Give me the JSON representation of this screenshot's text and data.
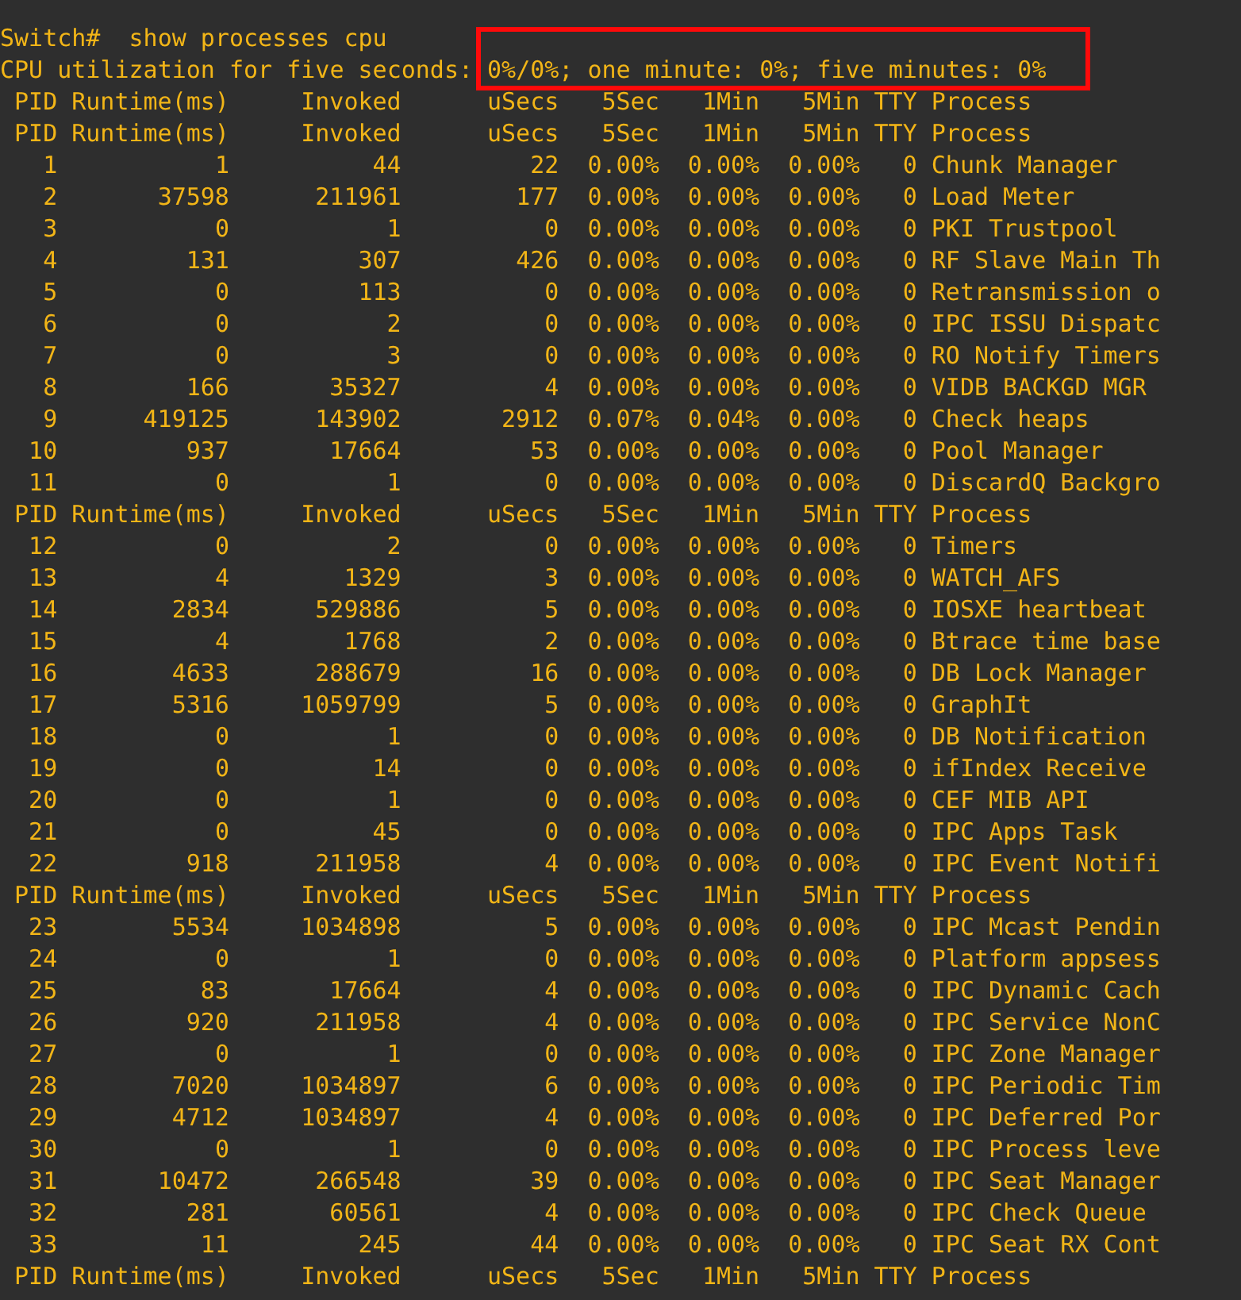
{
  "terminal": {
    "lines": [
      {
        "kind": "command",
        "text": "Switch#  show processes cpu"
      },
      {
        "kind": "summary",
        "label": "CPU utilization for five seconds:",
        "value": "0%/0%; one minute: 0%; five minutes: 0%",
        "highlighted": true
      },
      {
        "kind": "header",
        "cells": [
          "PID",
          "Runtime(ms)",
          "Invoked",
          "uSecs",
          "5Sec",
          "1Min",
          "5Min",
          "TTY",
          "Process"
        ]
      },
      {
        "kind": "header",
        "cells": [
          "PID",
          "Runtime(ms)",
          "Invoked",
          "uSecs",
          "5Sec",
          "1Min",
          "5Min",
          "TTY",
          "Process"
        ]
      },
      {
        "kind": "row",
        "cells": [
          "1",
          "1",
          "44",
          "22",
          "0.00%",
          "0.00%",
          "0.00%",
          "0",
          "Chunk Manager"
        ]
      },
      {
        "kind": "row",
        "cells": [
          "2",
          "37598",
          "211961",
          "177",
          "0.00%",
          "0.00%",
          "0.00%",
          "0",
          "Load Meter"
        ]
      },
      {
        "kind": "row",
        "cells": [
          "3",
          "0",
          "1",
          "0",
          "0.00%",
          "0.00%",
          "0.00%",
          "0",
          "PKI Trustpool"
        ]
      },
      {
        "kind": "row",
        "cells": [
          "4",
          "131",
          "307",
          "426",
          "0.00%",
          "0.00%",
          "0.00%",
          "0",
          "RF Slave Main Th"
        ]
      },
      {
        "kind": "row",
        "cells": [
          "5",
          "0",
          "113",
          "0",
          "0.00%",
          "0.00%",
          "0.00%",
          "0",
          "Retransmission o"
        ]
      },
      {
        "kind": "row",
        "cells": [
          "6",
          "0",
          "2",
          "0",
          "0.00%",
          "0.00%",
          "0.00%",
          "0",
          "IPC ISSU Dispatc"
        ]
      },
      {
        "kind": "row",
        "cells": [
          "7",
          "0",
          "3",
          "0",
          "0.00%",
          "0.00%",
          "0.00%",
          "0",
          "RO Notify Timers"
        ]
      },
      {
        "kind": "row",
        "cells": [
          "8",
          "166",
          "35327",
          "4",
          "0.00%",
          "0.00%",
          "0.00%",
          "0",
          "VIDB BACKGD MGR"
        ]
      },
      {
        "kind": "row",
        "cells": [
          "9",
          "419125",
          "143902",
          "2912",
          "0.07%",
          "0.04%",
          "0.00%",
          "0",
          "Check heaps"
        ]
      },
      {
        "kind": "row",
        "cells": [
          "10",
          "937",
          "17664",
          "53",
          "0.00%",
          "0.00%",
          "0.00%",
          "0",
          "Pool Manager"
        ]
      },
      {
        "kind": "row",
        "cells": [
          "11",
          "0",
          "1",
          "0",
          "0.00%",
          "0.00%",
          "0.00%",
          "0",
          "DiscardQ Backgro"
        ]
      },
      {
        "kind": "header",
        "cells": [
          "PID",
          "Runtime(ms)",
          "Invoked",
          "uSecs",
          "5Sec",
          "1Min",
          "5Min",
          "TTY",
          "Process"
        ]
      },
      {
        "kind": "row",
        "cells": [
          "12",
          "0",
          "2",
          "0",
          "0.00%",
          "0.00%",
          "0.00%",
          "0",
          "Timers"
        ]
      },
      {
        "kind": "row",
        "cells": [
          "13",
          "4",
          "1329",
          "3",
          "0.00%",
          "0.00%",
          "0.00%",
          "0",
          "WATCH_AFS"
        ]
      },
      {
        "kind": "row",
        "cells": [
          "14",
          "2834",
          "529886",
          "5",
          "0.00%",
          "0.00%",
          "0.00%",
          "0",
          "IOSXE heartbeat"
        ]
      },
      {
        "kind": "row",
        "cells": [
          "15",
          "4",
          "1768",
          "2",
          "0.00%",
          "0.00%",
          "0.00%",
          "0",
          "Btrace time base"
        ]
      },
      {
        "kind": "row",
        "cells": [
          "16",
          "4633",
          "288679",
          "16",
          "0.00%",
          "0.00%",
          "0.00%",
          "0",
          "DB Lock Manager"
        ]
      },
      {
        "kind": "row",
        "cells": [
          "17",
          "5316",
          "1059799",
          "5",
          "0.00%",
          "0.00%",
          "0.00%",
          "0",
          "GraphIt"
        ]
      },
      {
        "kind": "row",
        "cells": [
          "18",
          "0",
          "1",
          "0",
          "0.00%",
          "0.00%",
          "0.00%",
          "0",
          "DB Notification"
        ]
      },
      {
        "kind": "row",
        "cells": [
          "19",
          "0",
          "14",
          "0",
          "0.00%",
          "0.00%",
          "0.00%",
          "0",
          "ifIndex Receive"
        ]
      },
      {
        "kind": "row",
        "cells": [
          "20",
          "0",
          "1",
          "0",
          "0.00%",
          "0.00%",
          "0.00%",
          "0",
          "CEF MIB API"
        ]
      },
      {
        "kind": "row",
        "cells": [
          "21",
          "0",
          "45",
          "0",
          "0.00%",
          "0.00%",
          "0.00%",
          "0",
          "IPC Apps Task"
        ]
      },
      {
        "kind": "row",
        "cells": [
          "22",
          "918",
          "211958",
          "4",
          "0.00%",
          "0.00%",
          "0.00%",
          "0",
          "IPC Event Notifi"
        ]
      },
      {
        "kind": "header",
        "cells": [
          "PID",
          "Runtime(ms)",
          "Invoked",
          "uSecs",
          "5Sec",
          "1Min",
          "5Min",
          "TTY",
          "Process"
        ]
      },
      {
        "kind": "row",
        "cells": [
          "23",
          "5534",
          "1034898",
          "5",
          "0.00%",
          "0.00%",
          "0.00%",
          "0",
          "IPC Mcast Pendin"
        ]
      },
      {
        "kind": "row",
        "cells": [
          "24",
          "0",
          "1",
          "0",
          "0.00%",
          "0.00%",
          "0.00%",
          "0",
          "Platform appsess"
        ]
      },
      {
        "kind": "row",
        "cells": [
          "25",
          "83",
          "17664",
          "4",
          "0.00%",
          "0.00%",
          "0.00%",
          "0",
          "IPC Dynamic Cach"
        ]
      },
      {
        "kind": "row",
        "cells": [
          "26",
          "920",
          "211958",
          "4",
          "0.00%",
          "0.00%",
          "0.00%",
          "0",
          "IPC Service NonC"
        ]
      },
      {
        "kind": "row",
        "cells": [
          "27",
          "0",
          "1",
          "0",
          "0.00%",
          "0.00%",
          "0.00%",
          "0",
          "IPC Zone Manager"
        ]
      },
      {
        "kind": "row",
        "cells": [
          "28",
          "7020",
          "1034897",
          "6",
          "0.00%",
          "0.00%",
          "0.00%",
          "0",
          "IPC Periodic Tim"
        ]
      },
      {
        "kind": "row",
        "cells": [
          "29",
          "4712",
          "1034897",
          "4",
          "0.00%",
          "0.00%",
          "0.00%",
          "0",
          "IPC Deferred Por"
        ]
      },
      {
        "kind": "row",
        "cells": [
          "30",
          "0",
          "1",
          "0",
          "0.00%",
          "0.00%",
          "0.00%",
          "0",
          "IPC Process leve"
        ]
      },
      {
        "kind": "row",
        "cells": [
          "31",
          "10472",
          "266548",
          "39",
          "0.00%",
          "0.00%",
          "0.00%",
          "0",
          "IPC Seat Manager"
        ]
      },
      {
        "kind": "row",
        "cells": [
          "32",
          "281",
          "60561",
          "4",
          "0.00%",
          "0.00%",
          "0.00%",
          "0",
          "IPC Check Queue"
        ]
      },
      {
        "kind": "row",
        "cells": [
          "33",
          "11",
          "245",
          "44",
          "0.00%",
          "0.00%",
          "0.00%",
          "0",
          "IPC Seat RX Cont"
        ]
      },
      {
        "kind": "header",
        "cells": [
          "PID",
          "Runtime(ms)",
          "Invoked",
          "uSecs",
          "5Sec",
          "1Min",
          "5Min",
          "TTY",
          "Process"
        ]
      }
    ]
  }
}
